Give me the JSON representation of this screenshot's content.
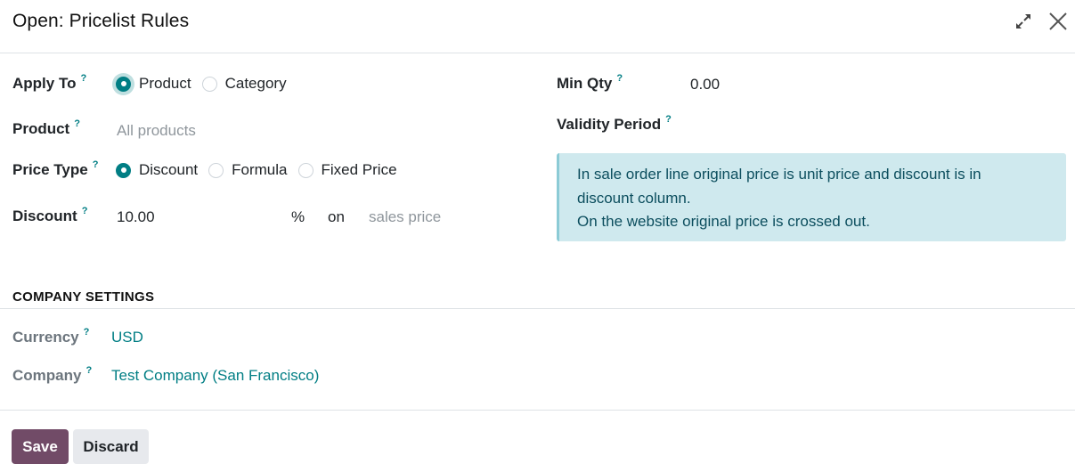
{
  "dialog": {
    "title": "Open: Pricelist Rules"
  },
  "icons": {
    "expand": "expand-arrows-icon",
    "close": "close-icon"
  },
  "help_mark": "?",
  "apply_to": {
    "label": "Apply To",
    "options": [
      "Product",
      "Category"
    ],
    "selected": "Product"
  },
  "product": {
    "label": "Product",
    "placeholder": "All products"
  },
  "price_type": {
    "label": "Price Type",
    "options": [
      "Discount",
      "Formula",
      "Fixed Price"
    ],
    "selected": "Discount"
  },
  "discount": {
    "label": "Discount",
    "value": "10.00",
    "unit": "%",
    "on": "on",
    "base_placeholder": "sales price"
  },
  "min_qty": {
    "label": "Min Qty",
    "value": "0.00"
  },
  "validity": {
    "label": "Validity Period"
  },
  "info": {
    "line1": "In sale order line original price is unit price and discount is in",
    "line2": "discount column.",
    "line3": "On the website original price is crossed out."
  },
  "company_settings": {
    "title": "COMPANY SETTINGS",
    "currency_label": "Currency",
    "currency_value": "USD",
    "company_label": "Company",
    "company_value": "Test Company (San Francisco)"
  },
  "footer": {
    "save": "Save",
    "discard": "Discard"
  },
  "colors": {
    "accent": "#017e84",
    "primary_button": "#714b67",
    "info_bg": "#cfe9ee"
  }
}
